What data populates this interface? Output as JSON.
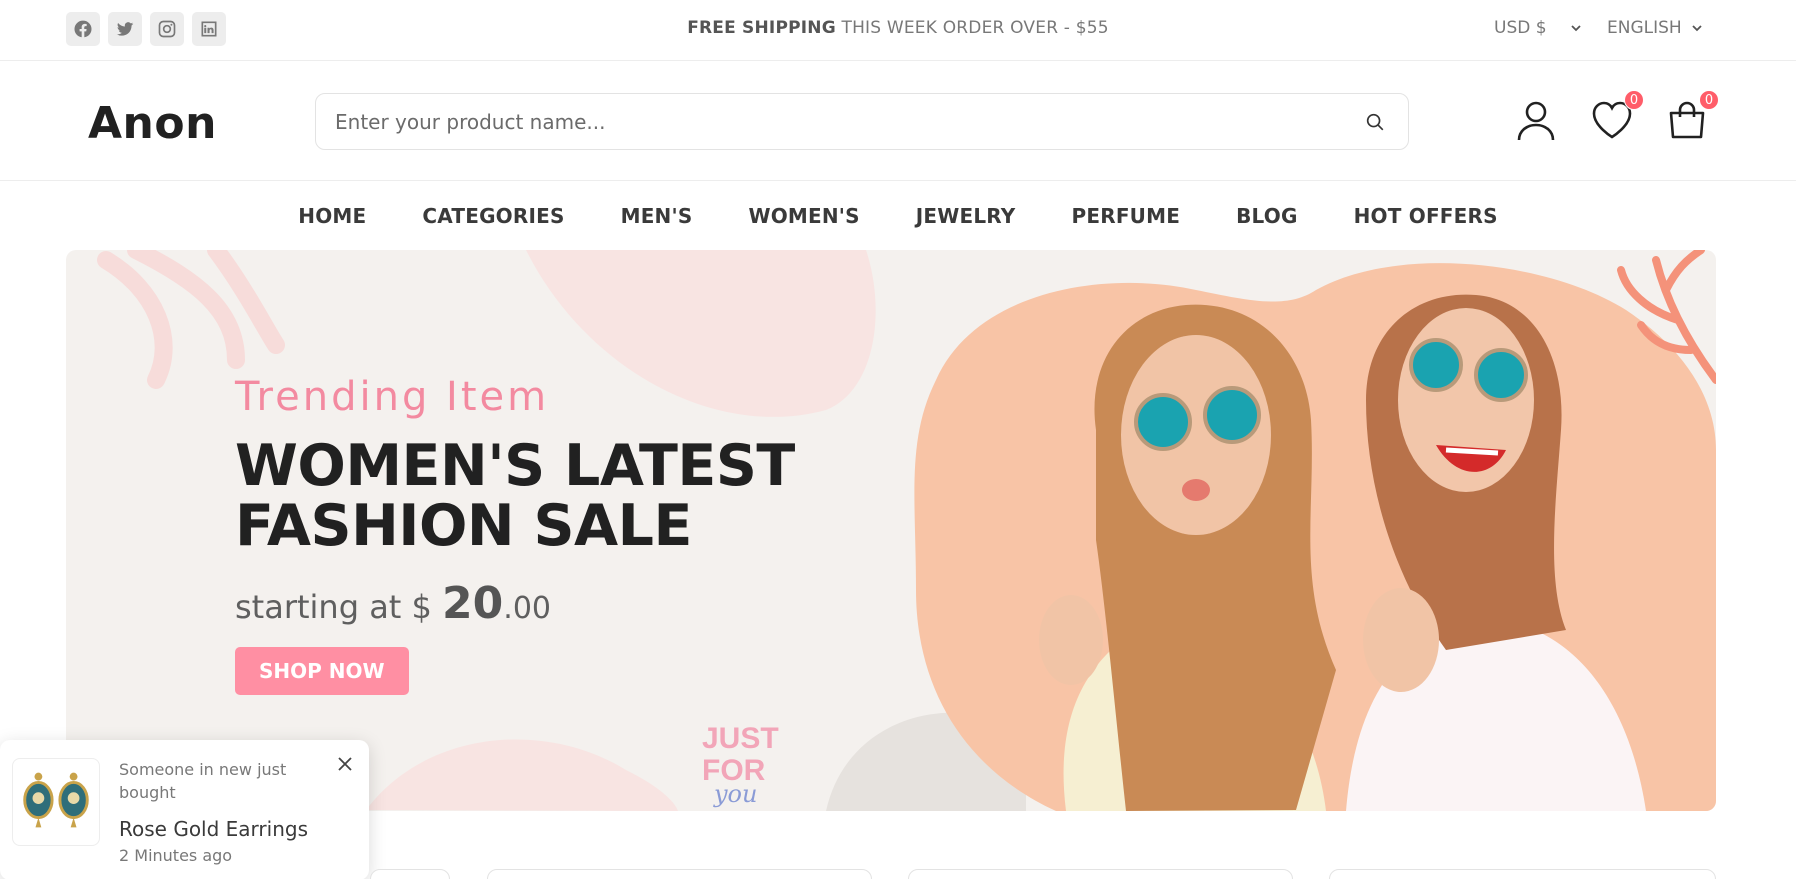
{
  "topbar": {
    "social": [
      {
        "icon": "facebook-icon"
      },
      {
        "icon": "twitter-icon"
      },
      {
        "icon": "instagram-icon"
      },
      {
        "icon": "linkedin-icon"
      }
    ],
    "shipping_bold": "FREE SHIPPING",
    "shipping_rest": " THIS WEEK ORDER OVER - $55",
    "currency": "USD $",
    "language": "ENGLISH"
  },
  "header": {
    "logo": "Anon",
    "search_placeholder": "Enter your product name...",
    "wishlist_count": "0",
    "cart_count": "0"
  },
  "nav": [
    "HOME",
    "CATEGORIES",
    "MEN'S",
    "WOMEN'S",
    "JEWELRY",
    "PERFUME",
    "BLOG",
    "HOT OFFERS"
  ],
  "banner": {
    "subtitle": "Trending Item",
    "title_line1": "WOMEN'S LATEST",
    "title_line2": "FASHION SALE",
    "price_prefix": "starting at $ ",
    "price_whole": "20",
    "price_cents": ".00",
    "cta": "SHOP NOW",
    "badge_line1": "JUST",
    "badge_line2": "FOR",
    "badge_line3": "you"
  },
  "toast": {
    "message": "Someone in new just bought",
    "product": "Rose Gold Earrings",
    "time": "2 Minutes ago"
  },
  "colors": {
    "accent": "#ff8fa3",
    "badge": "#ff5d69",
    "subtitle": "#f38aa0",
    "banner_bg": "#f4f1ee",
    "photo_bg": "#f8c4a6"
  }
}
